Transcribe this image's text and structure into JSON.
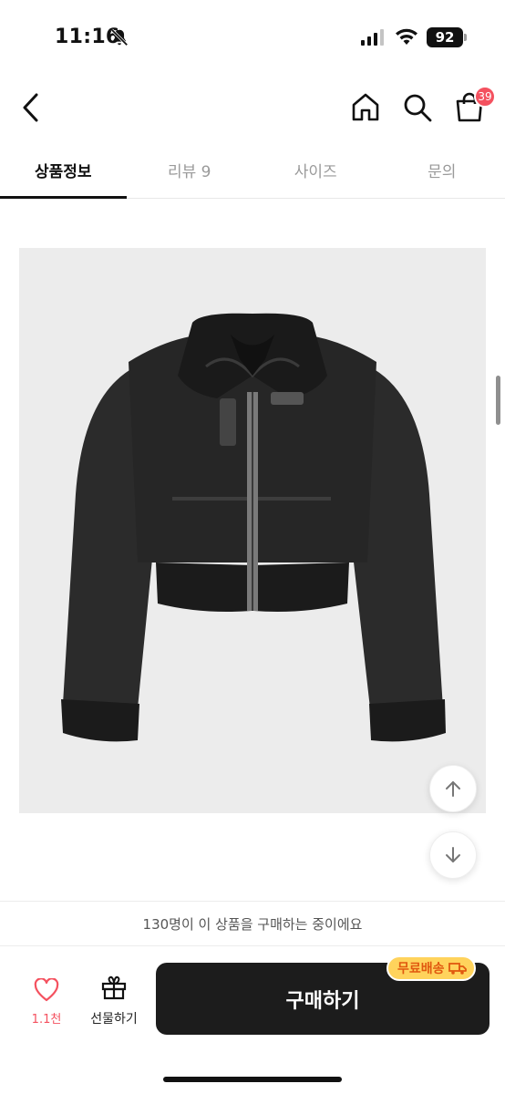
{
  "status_bar": {
    "time": "11:16",
    "battery": "92"
  },
  "nav": {
    "cart_count": "39"
  },
  "tabs": [
    {
      "label": "상품정보",
      "active": true
    },
    {
      "label": "리뷰 9",
      "active": false
    },
    {
      "label": "사이즈",
      "active": false
    },
    {
      "label": "문의",
      "active": false
    }
  ],
  "notice": {
    "text": "130명이 이 상품을 구매하는 중이에요"
  },
  "bottom_bar": {
    "like_count": "1.1천",
    "gift_label": "선물하기",
    "buy_label": "구매하기",
    "shipping_badge": "무료배송"
  },
  "colors": {
    "accent_red": "#f4515f",
    "buy_button": "#1c1c1c",
    "shipping_badge_bg": "#ffd35c",
    "shipping_badge_text": "#e0580f"
  },
  "icons": [
    "bell-slash-icon",
    "signal-icon",
    "wifi-icon",
    "back-icon",
    "home-icon",
    "search-icon",
    "cart-icon",
    "arrow-up-icon",
    "arrow-down-icon",
    "heart-icon",
    "gift-icon",
    "truck-icon"
  ]
}
